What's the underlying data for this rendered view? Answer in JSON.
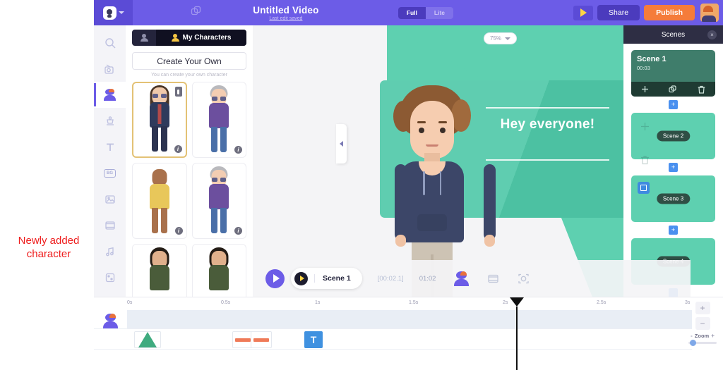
{
  "header": {
    "title": "Untitled Video",
    "subtitle": "Last edit saved",
    "mode_full": "Full",
    "mode_lite": "Lite",
    "share_label": "Share",
    "publish_label": "Publish",
    "publish_color": "#f57c3a",
    "bar_color": "#6c5ce7"
  },
  "rail": {
    "items": [
      {
        "name": "search",
        "label": "Search"
      },
      {
        "name": "scene",
        "label": "Scene"
      },
      {
        "name": "character",
        "label": "Character"
      },
      {
        "name": "prop",
        "label": "Props"
      },
      {
        "name": "text",
        "label": "T"
      },
      {
        "name": "background",
        "label": "BG"
      },
      {
        "name": "image",
        "label": "Image"
      },
      {
        "name": "video",
        "label": "Video"
      },
      {
        "name": "music",
        "label": "Music"
      },
      {
        "name": "effects",
        "label": "Effects"
      },
      {
        "name": "upload",
        "label": "Upload"
      }
    ],
    "active": "character"
  },
  "library": {
    "tab_label": "My Characters",
    "create_label": "Create Your Own",
    "create_hint": "You can create your own character",
    "selected_index": 0,
    "info_badge": "i",
    "characters": [
      {
        "name": "long-hair-sunglasses-suit",
        "hair": "#4a3526",
        "skin": "#f0c9ab",
        "top": "#2f3b5c",
        "bottom": "#2c3350",
        "glasses": true,
        "long_hair": true,
        "selected": true
      },
      {
        "name": "grey-hair-glasses-purple",
        "hair": "#b9b9bd",
        "skin": "#f3cdb2",
        "top": "#6c4f9e",
        "bottom": "#4a6fa8",
        "glasses": true,
        "long_hair": false,
        "selected": false
      },
      {
        "name": "bald-yellow-tank",
        "hair": "#8a5a3c",
        "skin": "#a9714c",
        "top": "#e8c75a",
        "bottom": "#e8c75a",
        "glasses": false,
        "long_hair": false,
        "selected": false
      },
      {
        "name": "grey-hair-glasses-purple-2",
        "hair": "#b9b9bd",
        "skin": "#f3cdb2",
        "top": "#6c4f9e",
        "bottom": "#4a6fa8",
        "glasses": true,
        "long_hair": false,
        "selected": false
      },
      {
        "name": "dark-hair-green-jacket",
        "hair": "#241c16",
        "skin": "#e0b08c",
        "top": "#4a5c3a",
        "bottom": "#3a4a30",
        "glasses": false,
        "long_hair": false,
        "selected": false
      },
      {
        "name": "dark-hair-green-jacket-2",
        "hair": "#241c16",
        "skin": "#e0b08c",
        "top": "#4a5c3a",
        "bottom": "#3a4a30",
        "glasses": false,
        "long_hair": false,
        "selected": false
      }
    ]
  },
  "canvas": {
    "zoom_level": "75%",
    "slide_text": "Hey everyone!",
    "accent_green": "#5ed0b0",
    "card_green": "#4fc8a8"
  },
  "playback": {
    "scene_label": "Scene 1",
    "current_time": "[00:02.1]",
    "total_time": "01:02"
  },
  "scenes": {
    "panel_title": "Scenes",
    "close_label": "×",
    "add_label": "+",
    "items": [
      {
        "name": "Scene 1",
        "duration": "00:03",
        "active": true
      },
      {
        "name": "Scene 2",
        "duration": "",
        "active": false
      },
      {
        "name": "Scene 3",
        "duration": "",
        "active": false
      },
      {
        "name": "Scene 4",
        "duration": "",
        "active": false
      }
    ]
  },
  "timeline": {
    "ticks": [
      "0s",
      "0.5s",
      "1s",
      "1.5s",
      "2s",
      "2.5s",
      "3s"
    ],
    "zoom_label": "Zoom",
    "zoom_in": "+",
    "zoom_out": "−",
    "zoom_minus_mini": "-",
    "zoom_plus_mini": "+",
    "text_clip_label": "T"
  },
  "annotation": {
    "line1": "Newly added",
    "line2": "character",
    "color": "#ee1c1c"
  }
}
